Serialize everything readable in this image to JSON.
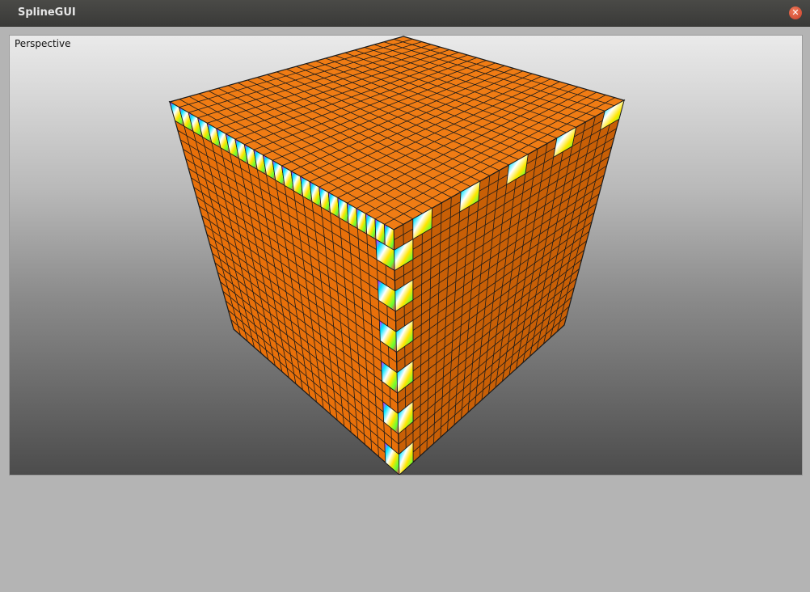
{
  "window": {
    "title": "SplineGUI",
    "close_glyph": "✕"
  },
  "viewport": {
    "label": "Perspective",
    "background_top": "#eaeaea",
    "background_bottom": "#4c4c4c"
  },
  "scene": {
    "object": "cube",
    "grid_divisions": 24,
    "face_color": "#e8700a",
    "top_face_color": "#f07c14",
    "right_face_color": "#c85f06",
    "grid_line_color": "#1a1a1a"
  }
}
